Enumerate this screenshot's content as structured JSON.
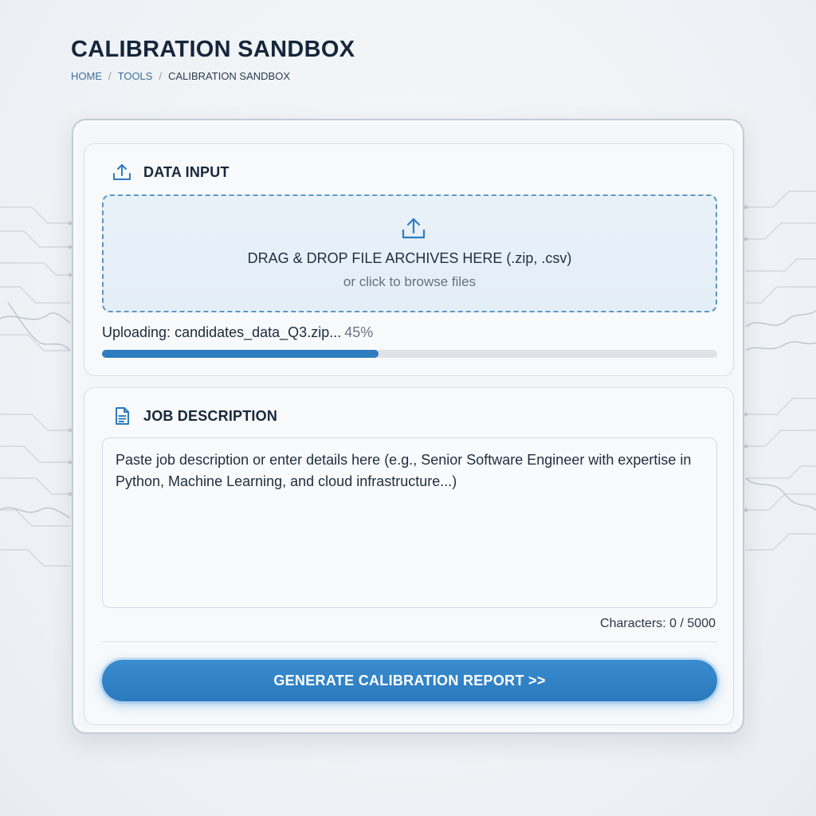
{
  "page": {
    "title": "CALIBRATION SANDBOX",
    "breadcrumb": {
      "items": [
        "HOME",
        "TOOLS",
        "CALIBRATION SANDBOX"
      ],
      "separator": "/"
    }
  },
  "data_input": {
    "header_icon": "upload-icon",
    "header": "DATA INPUT",
    "dropzone": {
      "icon": "upload-icon",
      "main_text": "DRAG & DROP FILE ARCHIVES HERE (.zip, .csv)",
      "sub_text": "or click to browse files"
    },
    "upload": {
      "status_text": "Uploading: candidates_data_Q3.zip...",
      "percent_text": "45%",
      "progress": 0.45
    }
  },
  "job_description": {
    "header_icon": "document-icon",
    "header": "JOB DESCRIPTION",
    "textarea": {
      "value": "",
      "placeholder": "Paste job description or enter details here (e.g., Senior Software Engineer with expertise in Python, Machine Learning, and cloud infrastructure...)"
    },
    "char_count": "Characters: 0 / 5000",
    "button_label": "GENERATE CALIBRATION REPORT >>"
  },
  "colors": {
    "accent": "#2f7cbf",
    "button": "#2a79bd",
    "dropzone_border": "#5d97c2",
    "progress_track": "#dfe3e8"
  }
}
